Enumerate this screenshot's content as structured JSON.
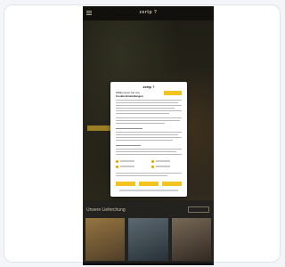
{
  "header": {
    "brand": "zertp ?"
  },
  "hero": {
    "text": ""
  },
  "section": {
    "title": "Unsere Lieferchung",
    "button": ""
  },
  "tiles": [
    {
      "caption": ""
    },
    {
      "caption": ""
    },
    {
      "caption": ""
    }
  ],
  "dialog": {
    "logo": "zertp ?",
    "heading": "Willkommen bei uns",
    "subheading": "Cookie-Einstellungen",
    "accept_button": "",
    "reject_button": "",
    "save_button": ""
  }
}
